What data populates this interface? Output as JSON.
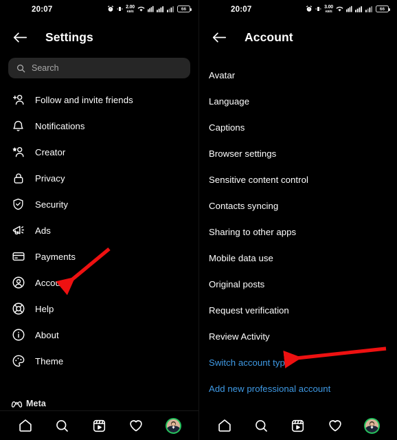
{
  "status_bar": {
    "time": "20:07",
    "icons": [
      "alarm-icon",
      "vibrate-icon",
      "network-speed",
      "wifi-icon",
      "signal-sim1-icon",
      "signal-sim2-icon",
      "battery-icon"
    ],
    "net_speed_left": "2.00",
    "net_speed_right": "3.00",
    "net_speed_unit": "KB/S",
    "battery_level": "66"
  },
  "settings_screen": {
    "title": "Settings",
    "back_icon": "arrow-left-icon",
    "search": {
      "placeholder": "Search",
      "icon": "search-icon"
    },
    "items": [
      {
        "label": "Follow and invite friends",
        "icon": "person-add-icon"
      },
      {
        "label": "Notifications",
        "icon": "bell-icon"
      },
      {
        "label": "Creator",
        "icon": "person-star-icon"
      },
      {
        "label": "Privacy",
        "icon": "lock-icon"
      },
      {
        "label": "Security",
        "icon": "shield-check-icon"
      },
      {
        "label": "Ads",
        "icon": "megaphone-icon"
      },
      {
        "label": "Payments",
        "icon": "credit-card-icon"
      },
      {
        "label": "Account",
        "icon": "person-circle-icon"
      },
      {
        "label": "Help",
        "icon": "lifebuoy-icon"
      },
      {
        "label": "About",
        "icon": "info-circle-icon"
      },
      {
        "label": "Theme",
        "icon": "palette-icon"
      }
    ],
    "footer": {
      "brand": "Meta",
      "icon": "meta-logo-icon"
    }
  },
  "account_screen": {
    "title": "Account",
    "back_icon": "arrow-left-icon",
    "items": [
      {
        "label": "Avatar",
        "link": false
      },
      {
        "label": "Language",
        "link": false
      },
      {
        "label": "Captions",
        "link": false
      },
      {
        "label": "Browser settings",
        "link": false
      },
      {
        "label": "Sensitive content control",
        "link": false
      },
      {
        "label": "Contacts syncing",
        "link": false
      },
      {
        "label": "Sharing to other apps",
        "link": false
      },
      {
        "label": "Mobile data use",
        "link": false
      },
      {
        "label": "Original posts",
        "link": false
      },
      {
        "label": "Request verification",
        "link": false
      },
      {
        "label": "Review Activity",
        "link": false
      },
      {
        "label": "Switch account type",
        "link": true
      },
      {
        "label": "Add new professional account",
        "link": true
      }
    ]
  },
  "bottom_nav": {
    "items": [
      "home-icon",
      "search-icon",
      "reels-icon",
      "heart-icon",
      "profile-avatar"
    ]
  },
  "annotations": [
    {
      "name": "arrow-to-account",
      "color": "#ee1111",
      "target": "Account"
    },
    {
      "name": "arrow-to-switch-account-type",
      "color": "#ee1111",
      "target": "Switch account type"
    }
  ],
  "colors": {
    "background": "#000000",
    "search_field": "#262626",
    "link_blue": "#3f9ae5",
    "arrow_red": "#ee1111",
    "avatar_ring_green": "#21c45d"
  }
}
